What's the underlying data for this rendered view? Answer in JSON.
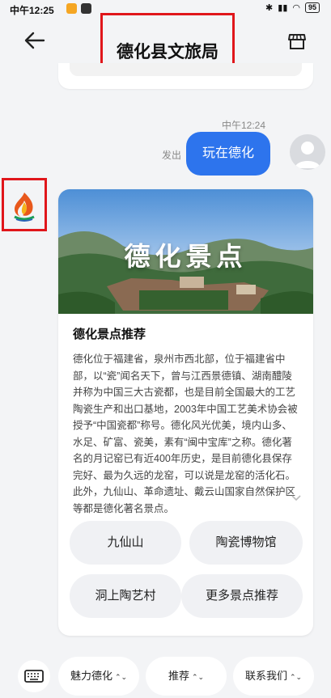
{
  "status_bar": {
    "time": "中午12:25",
    "battery": "95"
  },
  "header": {
    "title": "德化县文旅局"
  },
  "chat": {
    "timestamp": "中午12:24",
    "sent_label": "发出",
    "sent_message": "玩在德化"
  },
  "card": {
    "hero_text": "德化景点",
    "heading": "德化景点推荐",
    "body": "德化位于福建省，泉州市西北部，位于福建省中部，以“瓷”闻名天下，曾与江西景德镇、湖南醴陵并称为中国三大古瓷都，也是目前全国最大的工艺陶瓷生产和出口基地，2003年中国工艺美术协会被授予“中国瓷都”称号。德化风光优美，境内山多、水足、矿富、瓷美，素有“闽中宝库”之称。德化著名的月记窑已有近400年历史，是目前德化县保存完好、最为久远的龙窑，可以说是龙窑的活化石。此外，九仙山、革命遗址、戴云山国家自然保护区等都是德化著名景点。",
    "options": [
      "九仙山",
      "陶瓷博物馆",
      "洞上陶艺村",
      "更多景点推荐"
    ]
  },
  "bottom_menu": {
    "items": [
      "魅力德化",
      "推荐",
      "联系我们"
    ],
    "arrow": "⌃⌄"
  },
  "colors": {
    "accent": "#2d74ed",
    "highlight_border": "#e0161b"
  },
  "icons": [
    "back-arrow-icon",
    "store-icon",
    "user-avatar-icon",
    "bot-logo-icon",
    "chevron-down-icon",
    "keyboard-icon"
  ]
}
